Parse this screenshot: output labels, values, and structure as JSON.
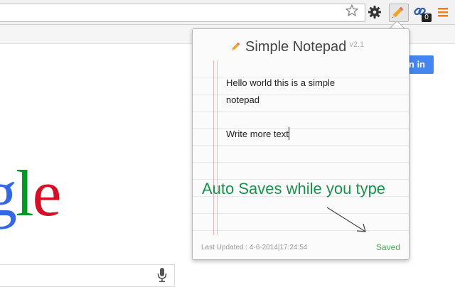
{
  "browser": {
    "badge_count": "0"
  },
  "google": {
    "signin_label": "in in",
    "logo_letters": [
      "g",
      "l",
      "e"
    ]
  },
  "popup": {
    "title": "Simple Notepad",
    "version": "v2.1",
    "note_lines": [
      "Hello world this is a simple",
      "notepad",
      "",
      "Write more text"
    ],
    "callout": "Auto Saves while you type",
    "last_updated_label": "Last Updated : 4-6-2014|17:24:54",
    "status": "Saved"
  },
  "colors": {
    "callout_green": "#16924a",
    "saved_green": "#4fa64f",
    "margin_red": "#f3b5b5",
    "google_blue": "#3369e8",
    "google_green": "#009925",
    "google_red": "#d50f25",
    "signin_blue": "#4585ef"
  },
  "icons": [
    "star-icon",
    "gear-icon",
    "pencil-icon",
    "link-icon",
    "menu-icon",
    "mic-icon"
  ]
}
